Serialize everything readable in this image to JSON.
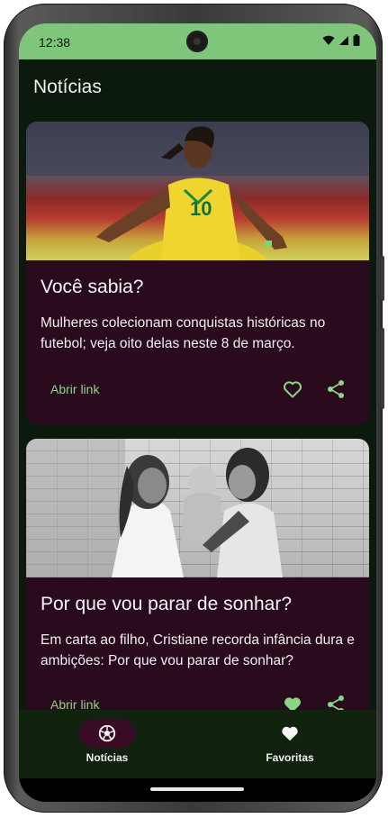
{
  "status_bar": {
    "time": "12:38",
    "icons": [
      "wifi-icon",
      "signal-icon",
      "battery-icon"
    ]
  },
  "app_bar": {
    "title": "Notícias"
  },
  "colors": {
    "status_bar": "#7fc67a",
    "background": "#0b1a0c",
    "card": "#2a0a1d",
    "accent": "#8dd486",
    "nav_indicator": "#3a0b25"
  },
  "cards": [
    {
      "image": "photo of a football player celebrating in a yellow jersey",
      "title": "Você sabia?",
      "text": "Mulheres colecionam conquistas históricas no futebol; veja oito delas neste 8 de março.",
      "link_label": "Abrir link",
      "favorite_icon": "heart-outline-icon",
      "share_icon": "share-icon"
    },
    {
      "image": "black and white photo of two women with a baby",
      "title": "Por que vou parar de sonhar?",
      "text": "Em carta ao filho, Cristiane recorda infância dura e ambições: Por que vou parar de sonhar?",
      "link_label": "Abrir link",
      "favorite_icon": "heart-filled-icon",
      "share_icon": "share-icon"
    }
  ],
  "bottom_nav": {
    "items": [
      {
        "label": "Notícias",
        "icon": "soccer-ball-icon",
        "selected": true
      },
      {
        "label": "Favoritas",
        "icon": "heart-filled-icon",
        "selected": false
      }
    ]
  }
}
